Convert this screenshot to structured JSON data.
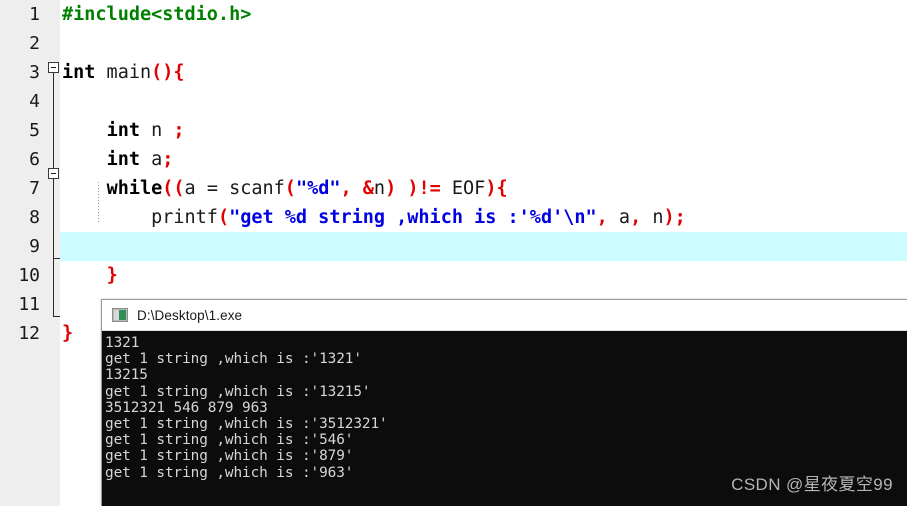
{
  "editor": {
    "gutter_bg": "#eeeeee",
    "background": "#ffffff",
    "highlight_color": "#ccfcff",
    "current_line": 9,
    "lines": [
      {
        "num": "1",
        "tokens": [
          {
            "t": "#include<stdio.h>",
            "c": "pre"
          }
        ]
      },
      {
        "num": "2",
        "tokens": []
      },
      {
        "num": "3",
        "tokens": [
          {
            "t": "int",
            "c": "kw"
          },
          {
            "t": " main",
            "c": "plain"
          },
          {
            "t": "(){",
            "c": "punc"
          }
        ]
      },
      {
        "num": "4",
        "tokens": []
      },
      {
        "num": "5",
        "tokens": [
          {
            "t": "    ",
            "c": "plain"
          },
          {
            "t": "int",
            "c": "kw"
          },
          {
            "t": " n ",
            "c": "plain"
          },
          {
            "t": ";",
            "c": "punc"
          }
        ]
      },
      {
        "num": "6",
        "tokens": [
          {
            "t": "    ",
            "c": "plain"
          },
          {
            "t": "int",
            "c": "kw"
          },
          {
            "t": " a",
            "c": "plain"
          },
          {
            "t": ";",
            "c": "punc"
          }
        ]
      },
      {
        "num": "7",
        "tokens": [
          {
            "t": "    ",
            "c": "plain"
          },
          {
            "t": "while",
            "c": "kw"
          },
          {
            "t": "((",
            "c": "punc"
          },
          {
            "t": "a = scanf",
            "c": "plain"
          },
          {
            "t": "(",
            "c": "punc"
          },
          {
            "t": "\"%d\"",
            "c": "str"
          },
          {
            "t": ",",
            "c": "punc"
          },
          {
            "t": " ",
            "c": "plain"
          },
          {
            "t": "&",
            "c": "punc"
          },
          {
            "t": "n",
            "c": "plain"
          },
          {
            "t": ")",
            "c": "punc"
          },
          {
            "t": " ",
            "c": "plain"
          },
          {
            "t": ")!=",
            "c": "punc"
          },
          {
            "t": " EOF",
            "c": "plain"
          },
          {
            "t": "){",
            "c": "punc"
          }
        ]
      },
      {
        "num": "8",
        "tokens": [
          {
            "t": "        printf",
            "c": "plain"
          },
          {
            "t": "(",
            "c": "punc"
          },
          {
            "t": "\"get %d string ,which is :'%d'\\n\"",
            "c": "str"
          },
          {
            "t": ",",
            "c": "punc"
          },
          {
            "t": " a",
            "c": "plain"
          },
          {
            "t": ",",
            "c": "punc"
          },
          {
            "t": " n",
            "c": "plain"
          },
          {
            "t": ");",
            "c": "punc"
          }
        ]
      },
      {
        "num": "9",
        "tokens": []
      },
      {
        "num": "10",
        "tokens": [
          {
            "t": "    ",
            "c": "plain"
          },
          {
            "t": "}",
            "c": "punc"
          }
        ]
      },
      {
        "num": "11",
        "tokens": []
      },
      {
        "num": "12",
        "tokens": [
          {
            "t": "}",
            "c": "punc"
          }
        ]
      }
    ]
  },
  "console": {
    "title": "D:\\Desktop\\1.exe",
    "icon": "console-window-icon",
    "background": "#0c0c0c",
    "text_color": "#d6d6d6",
    "output": [
      "1321",
      "get 1 string ,which is :'1321'",
      "13215",
      "get 1 string ,which is :'13215'",
      "3512321 546 879 963",
      "get 1 string ,which is :'3512321'",
      "get 1 string ,which is :'546'",
      "get 1 string ,which is :'879'",
      "get 1 string ,which is :'963'"
    ]
  },
  "watermark": {
    "text": "CSDN @星夜夏空99"
  }
}
